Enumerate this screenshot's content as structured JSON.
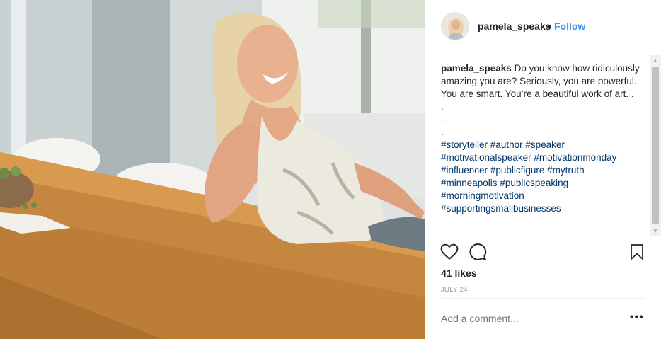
{
  "header": {
    "username": "pamela_speaks",
    "separator": "•",
    "follow_label": "Follow"
  },
  "caption": {
    "username": "pamela_speaks",
    "text": "Do you know how ridiculously amazing you are? Seriously, you are powerful. You are smart. You’re a beautiful work of art. .",
    "dots": [
      ".",
      ".",
      "."
    ],
    "hashtags": [
      [
        "#storyteller",
        "#author",
        "#speaker"
      ],
      [
        "#motivationalspeaker",
        "#motivationmonday"
      ],
      [
        "#influencer",
        "#publicfigure",
        "#mytruth"
      ],
      [
        "#minneapolis",
        "#publicspeaking"
      ],
      [
        "#morningmotivation"
      ],
      [
        "#supportingsmallbusinesses"
      ]
    ]
  },
  "actions": {
    "like_icon": "heart-icon",
    "comment_icon": "comment-icon",
    "save_icon": "bookmark-icon"
  },
  "likes": "41 likes",
  "date": "JULY 24",
  "comment_box": {
    "placeholder": "Add a comment..."
  },
  "more_label": "•••",
  "colors": {
    "follow": "#3897f0",
    "hashtag": "#003569",
    "muted": "#999999",
    "text": "#262626"
  }
}
